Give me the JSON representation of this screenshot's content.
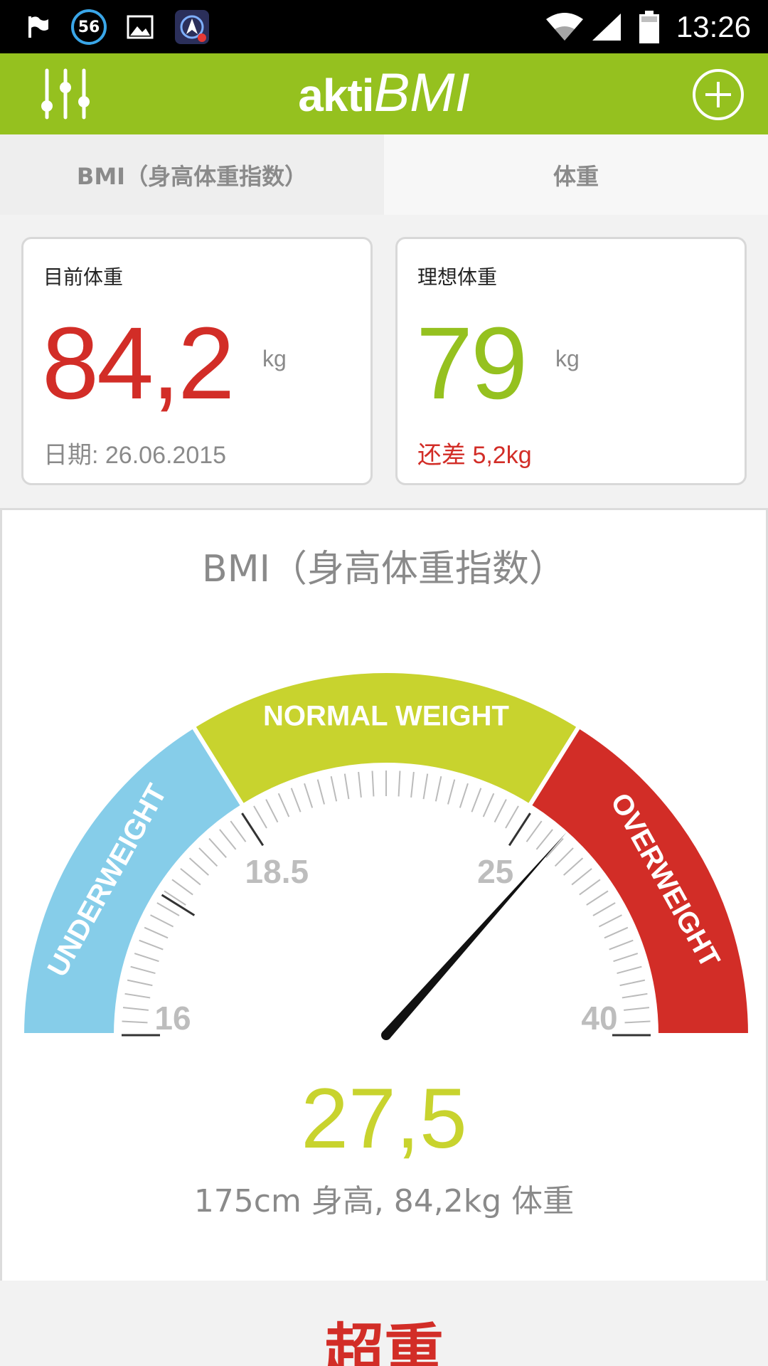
{
  "status_bar": {
    "notification_badge": "56",
    "time": "13:26",
    "icons": [
      "flag-icon",
      "image-icon",
      "app-icon",
      "wifi-icon",
      "signal-icon",
      "battery-icon"
    ]
  },
  "app_bar": {
    "logo_part1": "akti",
    "logo_part2": "BMI",
    "menu_icon": "sliders-icon",
    "add_icon": "plus-circle-icon"
  },
  "tabs": [
    {
      "label": "BMI（身高体重指数）",
      "active": true
    },
    {
      "label": "体重",
      "active": false
    }
  ],
  "current_weight": {
    "label": "目前体重",
    "value": "84,2",
    "unit": "kg",
    "date": "日期: 26.06.2015"
  },
  "ideal_weight": {
    "label": "理想体重",
    "value": "79",
    "unit": "kg",
    "remaining": "还差 5,2kg"
  },
  "bmi_panel": {
    "title": "BMI（身高体重指数）",
    "value": "27,5",
    "subtitle": "175cm 身高, 84,2kg 体重"
  },
  "gauge": {
    "min": 16,
    "max": 40,
    "value": 27.5,
    "tick_labels": [
      "16",
      "18.5",
      "25",
      "40"
    ],
    "bands": [
      {
        "label": "UNDERWEIGHT",
        "from": 16,
        "to": 18.5,
        "color": "#86cde9"
      },
      {
        "label": "NORMAL WEIGHT",
        "from": 18.5,
        "to": 25,
        "color": "#c8d32e"
      },
      {
        "label": "OVERWEIGHT",
        "from": 25,
        "to": 40,
        "color": "#d22d27"
      }
    ]
  },
  "result": {
    "label": "超重"
  },
  "colors": {
    "brand": "#95c11f",
    "warning": "#d22d27",
    "bmi_value": "#c8d32e"
  }
}
